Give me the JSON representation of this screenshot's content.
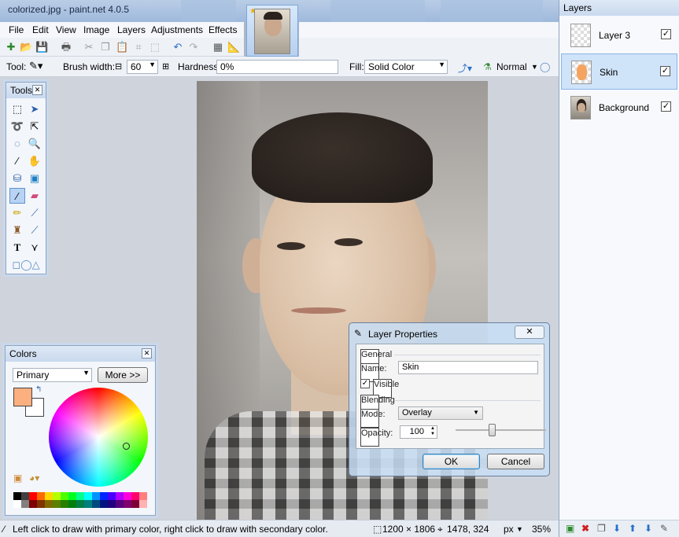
{
  "window": {
    "title": "colorized.jpg - paint.net 4.0.5"
  },
  "menu": [
    "File",
    "Edit",
    "View",
    "Image",
    "Layers",
    "Adjustments",
    "Effects"
  ],
  "toolbar": {
    "tool_label": "Tool:",
    "brush_width_label": "Brush width:",
    "brush_width_value": "60",
    "hardness_label": "Hardness:",
    "hardness_value": "0%",
    "fill_label": "Fill:",
    "fill_value": "Solid Color",
    "blend_mode": "Normal"
  },
  "tools_panel": {
    "title": "Tools"
  },
  "colors_panel": {
    "title": "Colors",
    "mode": "Primary",
    "more_label": "More >>",
    "primary_color": "#fdb07f",
    "secondary_color": "#ffffff"
  },
  "layers_panel": {
    "title": "Layers",
    "layers": [
      {
        "name": "Layer 3",
        "visible": true,
        "selected": false
      },
      {
        "name": "Skin",
        "visible": true,
        "selected": true
      },
      {
        "name": "Background",
        "visible": true,
        "selected": false
      }
    ]
  },
  "dialog": {
    "title": "Layer Properties",
    "general_label": "General",
    "name_label": "Name:",
    "name_value": "Skin",
    "visible_label": "Visible",
    "visible_checked": true,
    "blending_label": "Blending",
    "mode_label": "Mode:",
    "mode_value": "Overlay",
    "opacity_label": "Opacity:",
    "opacity_value": "100",
    "ok_label": "OK",
    "cancel_label": "Cancel"
  },
  "status": {
    "hint": "Left click to draw with primary color, right click to draw with secondary color.",
    "image_size": "1200 × 1806",
    "cursor_pos": "1478, 324",
    "units": "px",
    "zoom": "35%"
  }
}
